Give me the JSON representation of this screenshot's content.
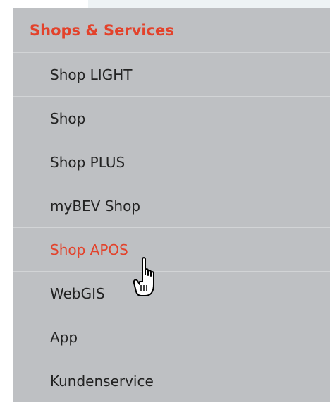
{
  "menu": {
    "header": "Shops & Services",
    "items": [
      {
        "label": "Shop LIGHT",
        "active": false
      },
      {
        "label": "Shop",
        "active": false
      },
      {
        "label": "Shop PLUS",
        "active": false
      },
      {
        "label": "myBEV Shop",
        "active": false
      },
      {
        "label": "Shop APOS",
        "active": true
      },
      {
        "label": "WebGIS",
        "active": false
      },
      {
        "label": "App",
        "active": false
      },
      {
        "label": "Kundenservice",
        "active": false
      }
    ]
  },
  "colors": {
    "accent": "#e3422b",
    "menu_background": "#bec0c3",
    "divider": "#d2d4d6",
    "text": "#222222"
  },
  "cursor": {
    "icon": "hand-pointer-icon"
  }
}
